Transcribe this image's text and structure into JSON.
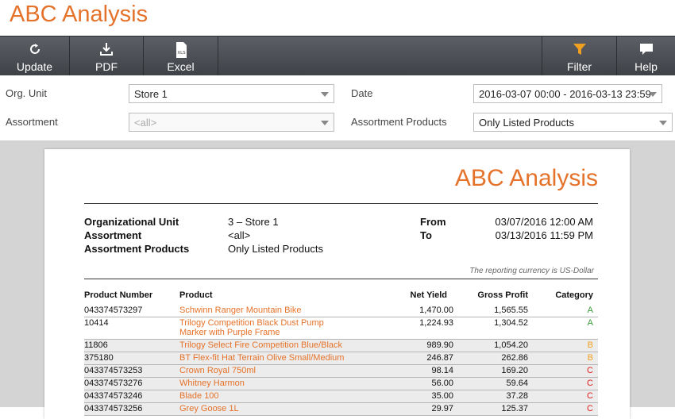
{
  "app": {
    "title": "ABC Analysis"
  },
  "toolbar": {
    "update": "Update",
    "pdf": "PDF",
    "excel": "Excel",
    "filter": "Filter",
    "help": "Help",
    "xls_badge": "XLS"
  },
  "filters": {
    "org_unit_label": "Org. Unit",
    "org_unit_value": "Store 1",
    "assortment_label": "Assortment",
    "assortment_value": "<all>",
    "date_label": "Date",
    "date_value": "2016-03-07 00:00 - 2016-03-13 23:59",
    "assortment_products_label": "Assortment Products",
    "assortment_products_value": "Only Listed Products"
  },
  "report": {
    "title": "ABC Analysis",
    "meta": {
      "org_unit_label": "Organizational Unit",
      "org_unit_value": "3 – Store 1",
      "assortment_label": "Assortment",
      "assortment_value": "<all>",
      "assortment_products_label": "Assortment Products",
      "assortment_products_value": "Only Listed Products",
      "from_label": "From",
      "from_value": "03/07/2016 12:00 AM",
      "to_label": "To",
      "to_value": "03/13/2016 11:59 PM"
    },
    "currency_note": "The reporting currency is US-Dollar",
    "columns": {
      "product_number": "Product Number",
      "product": "Product",
      "net_yield": "Net Yield",
      "gross_profit": "Gross Profit",
      "category": "Category"
    },
    "rows": [
      {
        "num": "043374573297",
        "product": "Schwinn Ranger Mountain Bike",
        "net_yield": "1,470.00",
        "gross": "1,565.55",
        "cat": "A"
      },
      {
        "num": "10414",
        "product": "Trilogy Competition Black Dust Pump Marker with Purple Frame",
        "net_yield": "1,224.93",
        "gross": "1,304.52",
        "cat": "A"
      },
      {
        "num": "11806",
        "product": "Trilogy Select Fire Competition Blue/Black",
        "net_yield": "989.90",
        "gross": "1,054.20",
        "cat": "B"
      },
      {
        "num": "375180",
        "product": "BT Flex-fit Hat Terrain Olive Small/Medium",
        "net_yield": "246.87",
        "gross": "262.86",
        "cat": "B"
      },
      {
        "num": "043374573253",
        "product": "Crown Royal 750ml",
        "net_yield": "98.14",
        "gross": "169.20",
        "cat": "C"
      },
      {
        "num": "043374573276",
        "product": "Whitney Harmon",
        "net_yield": "56.00",
        "gross": "59.64",
        "cat": "C"
      },
      {
        "num": "043374573246",
        "product": "Blade 100",
        "net_yield": "35.00",
        "gross": "37.28",
        "cat": "C"
      },
      {
        "num": "043374573256",
        "product": "Grey Goose 1L",
        "net_yield": "29.97",
        "gross": "125.37",
        "cat": "C"
      }
    ]
  },
  "colors": {
    "accent": "#e5722a",
    "toolbar": "#4a4d52",
    "cat_a": "#3a9a3a",
    "cat_b": "#f0a020",
    "cat_c": "#e02020"
  }
}
